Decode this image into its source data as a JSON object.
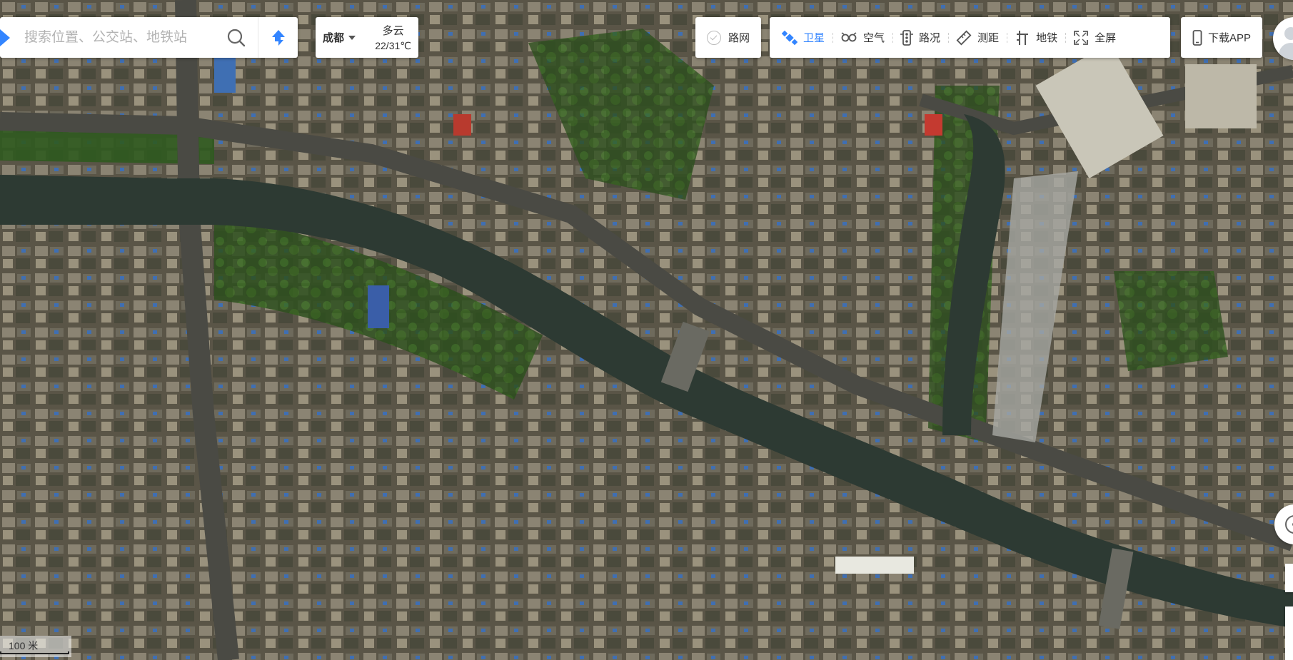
{
  "search": {
    "placeholder": "搜索位置、公交站、地铁站"
  },
  "weather": {
    "city": "成都",
    "description": "多云",
    "temperature": "22/31℃"
  },
  "road_net": {
    "label": "路网"
  },
  "toolbar": {
    "items": [
      {
        "label": "卫星",
        "icon": "satellite-icon",
        "active": true
      },
      {
        "label": "空气",
        "icon": "air-icon",
        "active": false
      },
      {
        "label": "路况",
        "icon": "traffic-light-icon",
        "active": false
      },
      {
        "label": "测距",
        "icon": "ruler-icon",
        "active": false
      },
      {
        "label": "地铁",
        "icon": "subway-icon",
        "active": false
      },
      {
        "label": "全屏",
        "icon": "fullscreen-icon",
        "active": false
      }
    ]
  },
  "download": {
    "label": "下载APP",
    "icon": "phone-icon"
  },
  "scale": {
    "label": "100 米"
  },
  "colors": {
    "accent": "#3385ff",
    "river": "#2d3a33",
    "vegetation": "#2f5a1f",
    "urban": "#6b6555"
  }
}
